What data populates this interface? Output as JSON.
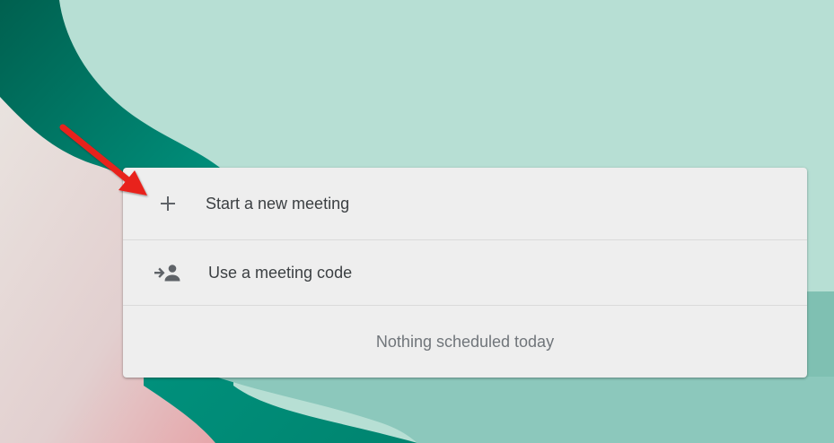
{
  "menu": {
    "items": [
      {
        "label": "Start a new meeting",
        "icon": "plus-icon"
      },
      {
        "label": "Use a meeting code",
        "icon": "person-add-icon"
      }
    ],
    "empty_state": "Nothing scheduled today"
  },
  "colors": {
    "card_background": "#eeeeee",
    "text_primary": "#3c4043",
    "text_secondary": "#70757a",
    "icon": "#5f6368",
    "background_mint": "#b7dfd4",
    "background_teal": "#00897b",
    "annotation_arrow": "#e8211c"
  }
}
